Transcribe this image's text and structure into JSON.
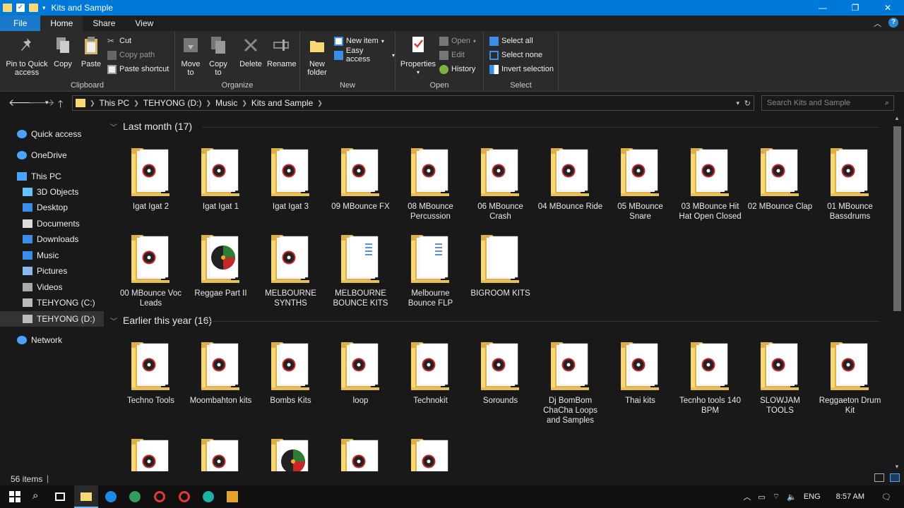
{
  "window": {
    "title": "Kits and Sample",
    "controls": [
      "minimize",
      "maximize",
      "close"
    ]
  },
  "tabs": [
    "File",
    "Home",
    "Share",
    "View"
  ],
  "active_tab": "Home",
  "ribbon": {
    "clipboard": {
      "label": "Clipboard",
      "pin": "Pin to Quick access",
      "copy": "Copy",
      "paste": "Paste",
      "cut": "Cut",
      "copy_path": "Copy path",
      "paste_shortcut": "Paste shortcut"
    },
    "organize": {
      "label": "Organize",
      "move_to": "Move to",
      "copy_to": "Copy to",
      "delete": "Delete",
      "rename": "Rename"
    },
    "new": {
      "label": "New",
      "new_folder": "New folder",
      "new_item": "New item",
      "easy_access": "Easy access"
    },
    "open": {
      "label": "Open",
      "properties": "Properties",
      "open": "Open",
      "edit": "Edit",
      "history": "History"
    },
    "select": {
      "label": "Select",
      "select_all": "Select all",
      "select_none": "Select none",
      "invert_selection": "Invert selection"
    }
  },
  "address": {
    "crumbs": [
      "This PC",
      "TEHYONG (D:)",
      "Music",
      "Kits and Sample"
    ],
    "search_placeholder": "Search Kits and Sample"
  },
  "sidebar": [
    {
      "label": "Quick access",
      "icon": "star-icon"
    },
    {
      "label": "OneDrive",
      "icon": "cloud-icon"
    },
    {
      "label": "This PC",
      "icon": "computer-icon"
    },
    {
      "label": "3D Objects",
      "icon": "cube-icon"
    },
    {
      "label": "Desktop",
      "icon": "desktop-icon"
    },
    {
      "label": "Documents",
      "icon": "document-icon"
    },
    {
      "label": "Downloads",
      "icon": "download-icon"
    },
    {
      "label": "Music",
      "icon": "music-icon"
    },
    {
      "label": "Pictures",
      "icon": "picture-icon"
    },
    {
      "label": "Videos",
      "icon": "video-icon"
    },
    {
      "label": "TEHYONG (C:)",
      "icon": "drive-icon"
    },
    {
      "label": "TEHYONG (D:)",
      "icon": "drive-icon"
    },
    {
      "label": "Network",
      "icon": "network-icon"
    }
  ],
  "groups": [
    {
      "header": "Last month (17)",
      "folders": [
        {
          "name": "Igat Igat 2",
          "icon": "record"
        },
        {
          "name": "Igat Igat 1",
          "icon": "record"
        },
        {
          "name": "Igat Igat 3",
          "icon": "record"
        },
        {
          "name": "09 MBounce FX",
          "icon": "record"
        },
        {
          "name": "08 MBounce Percussion",
          "icon": "record"
        },
        {
          "name": "06 MBounce Crash",
          "icon": "record"
        },
        {
          "name": "04 MBounce Ride",
          "icon": "record"
        },
        {
          "name": "05 MBounce Snare",
          "icon": "record"
        },
        {
          "name": "03 MBounce Hit Hat Open Closed",
          "icon": "record"
        },
        {
          "name": "02 MBounce Clap",
          "icon": "record"
        },
        {
          "name": "01 MBounce Bassdrums",
          "icon": "record"
        },
        {
          "name": "00 MBounce Voc Leads",
          "icon": "record"
        },
        {
          "name": "Reggae Part II",
          "icon": "vinyl"
        },
        {
          "name": "MELBOURNE SYNTHS",
          "icon": "record"
        },
        {
          "name": "MELBOURNE BOUNCE KITS",
          "icon": "docs"
        },
        {
          "name": "Melbourne Bounce FLP",
          "icon": "docs"
        },
        {
          "name": "BIGROOM KITS",
          "icon": "plain"
        }
      ]
    },
    {
      "header": "Earlier this year (16)",
      "folders": [
        {
          "name": "Techno Tools",
          "icon": "record"
        },
        {
          "name": "Moombahton kits",
          "icon": "record"
        },
        {
          "name": "Bombs Kits",
          "icon": "record"
        },
        {
          "name": "loop",
          "icon": "record"
        },
        {
          "name": "Technokit",
          "icon": "record"
        },
        {
          "name": "Sorounds",
          "icon": "record"
        },
        {
          "name": "Dj BomBom ChaCha Loops and Samples",
          "icon": "record"
        },
        {
          "name": "Thai kits",
          "icon": "record"
        },
        {
          "name": "Tecnho tools 140 BPM",
          "icon": "record"
        },
        {
          "name": "SLOWJAM TOOLS",
          "icon": "record"
        },
        {
          "name": "Reggaeton Drum Kit",
          "icon": "record"
        },
        {
          "name": "",
          "icon": "record"
        },
        {
          "name": "",
          "icon": "record"
        },
        {
          "name": "",
          "icon": "vinyl"
        },
        {
          "name": "",
          "icon": "record"
        },
        {
          "name": "",
          "icon": "record"
        }
      ]
    }
  ],
  "status": {
    "items": "56 items"
  },
  "tray": {
    "lang": "ENG",
    "time": "8:57 AM"
  },
  "colors": {
    "titlebar": "#0078d7",
    "folder": "#f8d775",
    "accent": "#1979ca"
  }
}
